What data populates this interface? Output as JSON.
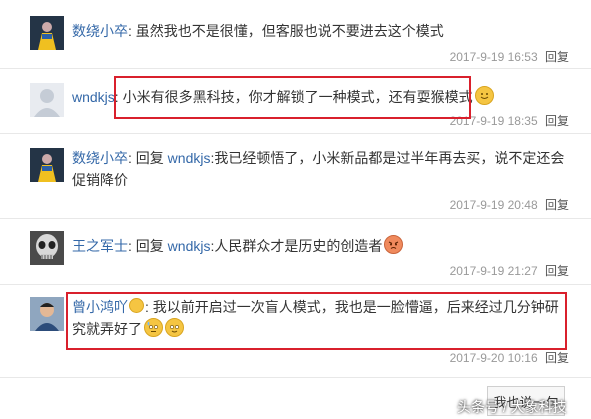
{
  "replies": [
    {
      "author": "数绕小卒",
      "colon": ": ",
      "text": "虽然我也不是很懂，但客服也说不要进去这个模式",
      "time": "2017-9-19 16:53",
      "reply_label": "回复"
    },
    {
      "author": "wndkjs",
      "colon": ": ",
      "text": "小米有很多黑科技，你才解锁了一种模式，还有耍猴模式",
      "time": "2017-9-19 18:35",
      "reply_label": "回复"
    },
    {
      "author": "数绕小卒",
      "colon": ": ",
      "reply_word": "回复 ",
      "reply_to": "wndkjs",
      "text": ":我已经顿悟了，小米新品都是过半年再去买，说不定还会促销降价",
      "time": "2017-9-19 20:48",
      "reply_label": "回复"
    },
    {
      "author": "王之军士",
      "colon": ": ",
      "reply_word": "回复 ",
      "reply_to": "wndkjs",
      "text": ":人民群众才是历史的创造者",
      "time": "2017-9-19 21:27",
      "reply_label": "回复"
    },
    {
      "author": "曾小鸿吖",
      "colon": ": ",
      "text": "我以前开启过一次盲人模式，我也是一脸懵逼，后来经过几分钟研究就弄好了",
      "time": "2017-9-20 10:16",
      "reply_label": "回复"
    }
  ],
  "say_button": "我也说一句",
  "watermark": "头条号 / 大象科技",
  "colors": {
    "link": "#3468a8",
    "highlight": "#d9202c"
  }
}
